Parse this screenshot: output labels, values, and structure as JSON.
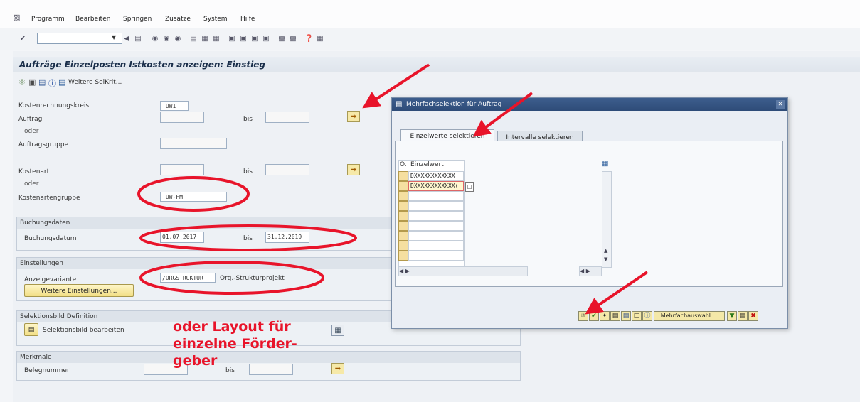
{
  "menu": {
    "items": [
      "Programm",
      "Bearbeiten",
      "Springen",
      "Zusätze",
      "System",
      "Hilfe"
    ]
  },
  "screen": {
    "title": "Aufträge Einzelposten Istkosten anzeigen: Einstieg",
    "app_toolbar": {
      "more_selections_label": "Weitere SelKrit..."
    }
  },
  "form": {
    "kostenrechnungskreis": {
      "label": "Kostenrechnungskreis",
      "value": "TUW1"
    },
    "auftrag": {
      "label": "Auftrag",
      "from": "",
      "bis_label": "bis",
      "to": ""
    },
    "oder1": "oder",
    "auftragsgruppe": {
      "label": "Auftragsgruppe",
      "value": ""
    },
    "kostenart": {
      "label": "Kostenart",
      "from": "",
      "bis_label": "bis",
      "to": ""
    },
    "oder2": "oder",
    "kostenartengruppe": {
      "label": "Kostenartengruppe",
      "value": "TUW-FM"
    },
    "buchungsdaten": {
      "header": "Buchungsdaten",
      "label": "Buchungsdatum",
      "from": "01.07.2017",
      "bis_label": "bis",
      "to": "31.12.2019"
    },
    "einstellungen": {
      "header": "Einstellungen",
      "label": "Anzeigevariante",
      "value": "/ORGSTRUKTUR",
      "desc": "Org.-Strukturprojekt",
      "button": "Weitere Einstellungen..."
    },
    "selektionsbild": {
      "header": "Selektionsbild Definition",
      "button": "Selektionsbild bearbeiten"
    },
    "merkmale": {
      "header": "Merkmale",
      "label": "Belegnummer",
      "from": "",
      "bis_label": "bis",
      "to": ""
    }
  },
  "dialog": {
    "title": "Mehrfachselektion für Auftrag",
    "tabs": [
      "Einzelwerte selektieren",
      "Intervalle selektieren"
    ],
    "table": {
      "col_o": "O.",
      "col_value": "Einzelwert",
      "rows": [
        "DXXXXXXXXXXXX",
        "DXXXXXXXXXXXX(",
        "",
        "",
        "",
        "",
        "",
        "",
        ""
      ]
    },
    "footer_button": "Mehrfachauswahl ..."
  },
  "annotation": {
    "lines": [
      "oder Layout für",
      "einzelne Förder-",
      "geber"
    ],
    "color": "#e8142a"
  }
}
